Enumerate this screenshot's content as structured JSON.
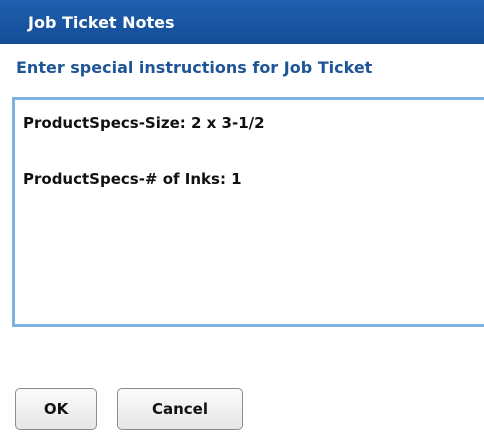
{
  "dialog": {
    "title": "Job Ticket Notes",
    "instruction": "Enter special instructions for Job Ticket",
    "notes_value": "ProductSpecs-Size: 2 x 3-1/2\n\nProductSpecs-# of Inks: 1",
    "ok_label": "OK",
    "cancel_label": "Cancel"
  },
  "colors": {
    "titlebar": "#1a56a3",
    "instruction_text": "#1f5596",
    "textarea_border": "#7fb2e0"
  }
}
